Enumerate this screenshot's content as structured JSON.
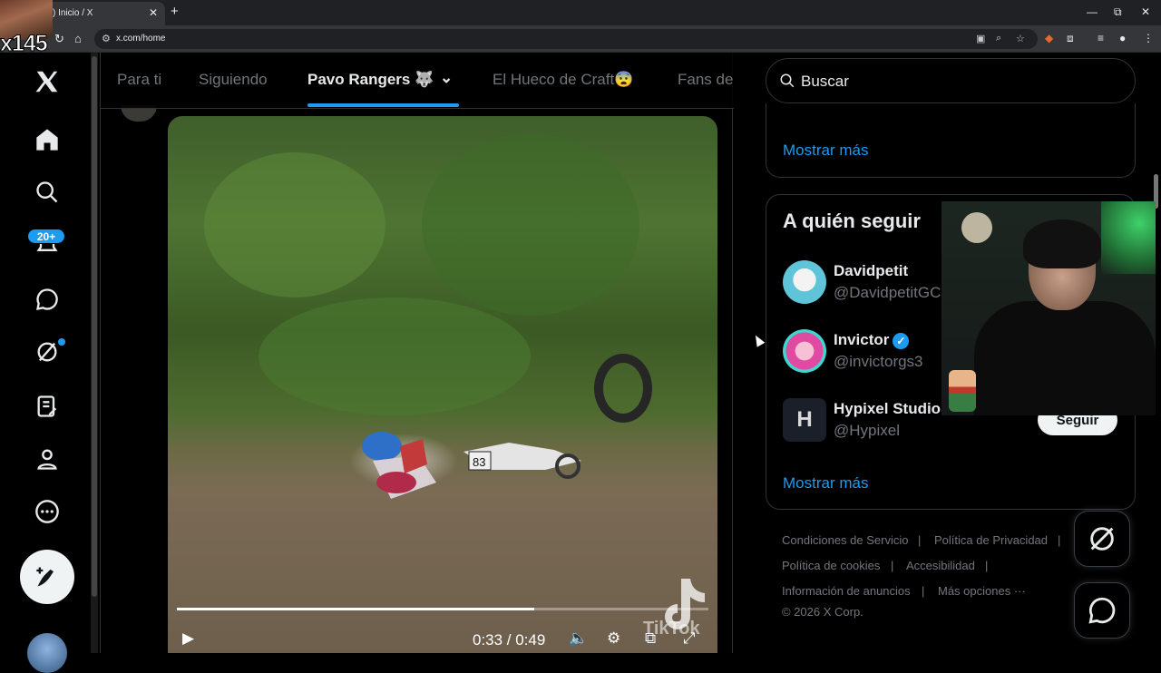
{
  "browser": {
    "tab_title": ") Inicio / X",
    "tab_close": "✕",
    "new_tab": "+",
    "url": "x.com/home",
    "window_controls": [
      "—",
      "⧉",
      "✕"
    ]
  },
  "overlay": {
    "multiplier": "x145"
  },
  "nav": {
    "notifications_badge": "20+",
    "icons": [
      "x-logo-icon",
      "home-icon",
      "search-icon",
      "notifications-icon",
      "messages-icon",
      "grok-icon",
      "lists-icon",
      "profile-icon",
      "more-icon",
      "post-icon"
    ]
  },
  "timeline_tabs": [
    {
      "label": "Para ti"
    },
    {
      "label": "Siguiendo"
    },
    {
      "label": "Pavo Rangers 🐺"
    },
    {
      "label": "El Hueco de Craft😨"
    },
    {
      "label": "Fans de"
    }
  ],
  "video": {
    "current_time": "0:33",
    "duration": "0:49",
    "time_display": "0:33 / 0:49",
    "progress_fraction": 0.673,
    "watermark": "TikTok"
  },
  "sidebar": {
    "search_placeholder": "Buscar",
    "show_more_1": "Mostrar más",
    "who_to_follow_title": "A quién seguir",
    "users": [
      {
        "name": "Davidpetit",
        "handle": "@DavidpetitGC",
        "verified": false
      },
      {
        "name": "Invictor",
        "handle": "@invictorgs3",
        "verified": true
      },
      {
        "name": "Hypixel Studios",
        "handle": "@Hypixel",
        "verified": false
      }
    ],
    "follow_label": "Seguir",
    "show_more_2": "Mostrar más",
    "footer": {
      "terms": "Condiciones de Servicio",
      "privacy": "Política de Privacidad",
      "cookies": "Política de cookies",
      "accessibility": "Accesibilidad",
      "ads_info": "Información de anuncios",
      "more": "Más opciones ···",
      "copyright": "© 2026 X Corp."
    }
  },
  "colors": {
    "accent": "#1d9bf0",
    "background": "#000000",
    "text": "#e7e9ea",
    "muted": "#71767b"
  }
}
